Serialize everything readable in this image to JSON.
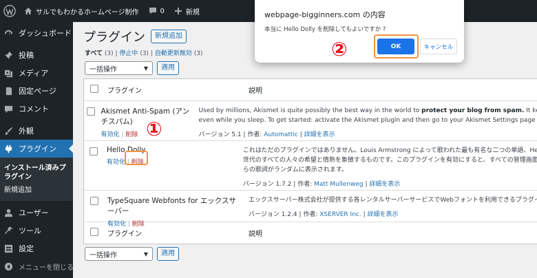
{
  "adminbar": {
    "site_name": "サルでもわかるホームページ制作",
    "comments_count": "0",
    "new_label": "新規"
  },
  "sidebar": {
    "items": [
      {
        "label": "ダッシュボード",
        "icon": "dashboard-icon"
      },
      {
        "label": "投稿",
        "icon": "pin-icon"
      },
      {
        "label": "メディア",
        "icon": "media-icon"
      },
      {
        "label": "固定ページ",
        "icon": "page-icon"
      },
      {
        "label": "コメント",
        "icon": "comment-icon"
      },
      {
        "label": "外観",
        "icon": "brush-icon"
      },
      {
        "label": "プラグイン",
        "icon": "plugin-icon"
      },
      {
        "label": "ユーザー",
        "icon": "user-icon"
      },
      {
        "label": "ツール",
        "icon": "wrench-icon"
      },
      {
        "label": "設定",
        "icon": "settings-icon"
      }
    ],
    "submenu": {
      "installed": "インストール済みプラグイン",
      "add_new": "新規追加"
    },
    "collapse_label": "メニューを閉じる"
  },
  "main": {
    "title": "プラグイン",
    "add_new_button": "新規追加",
    "filters": {
      "all": "すべて",
      "all_count": "(3)",
      "inactive": "停止中",
      "inactive_count": "(3)",
      "auto_update_disabled": "自動更新無効",
      "auto_update_disabled_count": "(3)"
    },
    "bulk_select": "一括操作",
    "apply_button": "適用",
    "columns": {
      "plugin": "プラグイン",
      "description": "説明"
    }
  },
  "plugins": [
    {
      "name": "Akismet Anti-Spam (アンチスパム)",
      "activate": "有効化",
      "delete": "削除",
      "desc_line1_a": "Used by millions, Akismet is quite possibly the best way in the world to ",
      "desc_line1_b": "protect your blog from spam.",
      "desc_line1_c": " It keep",
      "desc_line2": "even while you sleep. To get started: activate the Akismet plugin and then go to your Akismet Settings page t",
      "version": "バージョン 5.1",
      "author_label": "作者: ",
      "author": "Automattic",
      "details": "詳細を表示"
    },
    {
      "name": "Hello Dolly",
      "activate": "有効化",
      "delete": "削除",
      "desc_line1": "これはただのプラグインではありません。Louis Armstrong によって歌われた最も有名な二つの単語、Hello,",
      "desc_line2": "世代のすべての人々の希望と情熱を象徴するものです。このプラグインを有効にすると、すべての管理画面",
      "desc_line3": "らの歌詞がランダムに表示されます。",
      "version": "バージョン 1.7.2",
      "author_label": "作者: ",
      "author": "Matt Mullenweg",
      "details": "詳細を表示"
    },
    {
      "name": "TypeSquare Webfonts for エックスサーバー",
      "activate": "有効化",
      "delete": "削除",
      "desc_line1": "エックスサーバー株式会社が提供する各レンタルサーバーサービスでWebフォントを利用できるプラグイン",
      "version": "バージョン 1.2.4",
      "author_label": "作者: ",
      "author": "XSERVER Inc.",
      "details": "詳細を表示"
    }
  ],
  "dialog": {
    "title": "webpage-bigginners.com の内容",
    "message": "本当に Hello Dolly を削除してもよいですか ?",
    "ok": "OK",
    "cancel": "キャンセル"
  },
  "annotations": {
    "step1": "①",
    "step2": "②",
    "color": "#e8101f",
    "highlight_color": "#f2923a"
  },
  "colors": {
    "admin_bg": "#1d2327",
    "accent": "#2271b1",
    "delete": "#b32d2e"
  }
}
